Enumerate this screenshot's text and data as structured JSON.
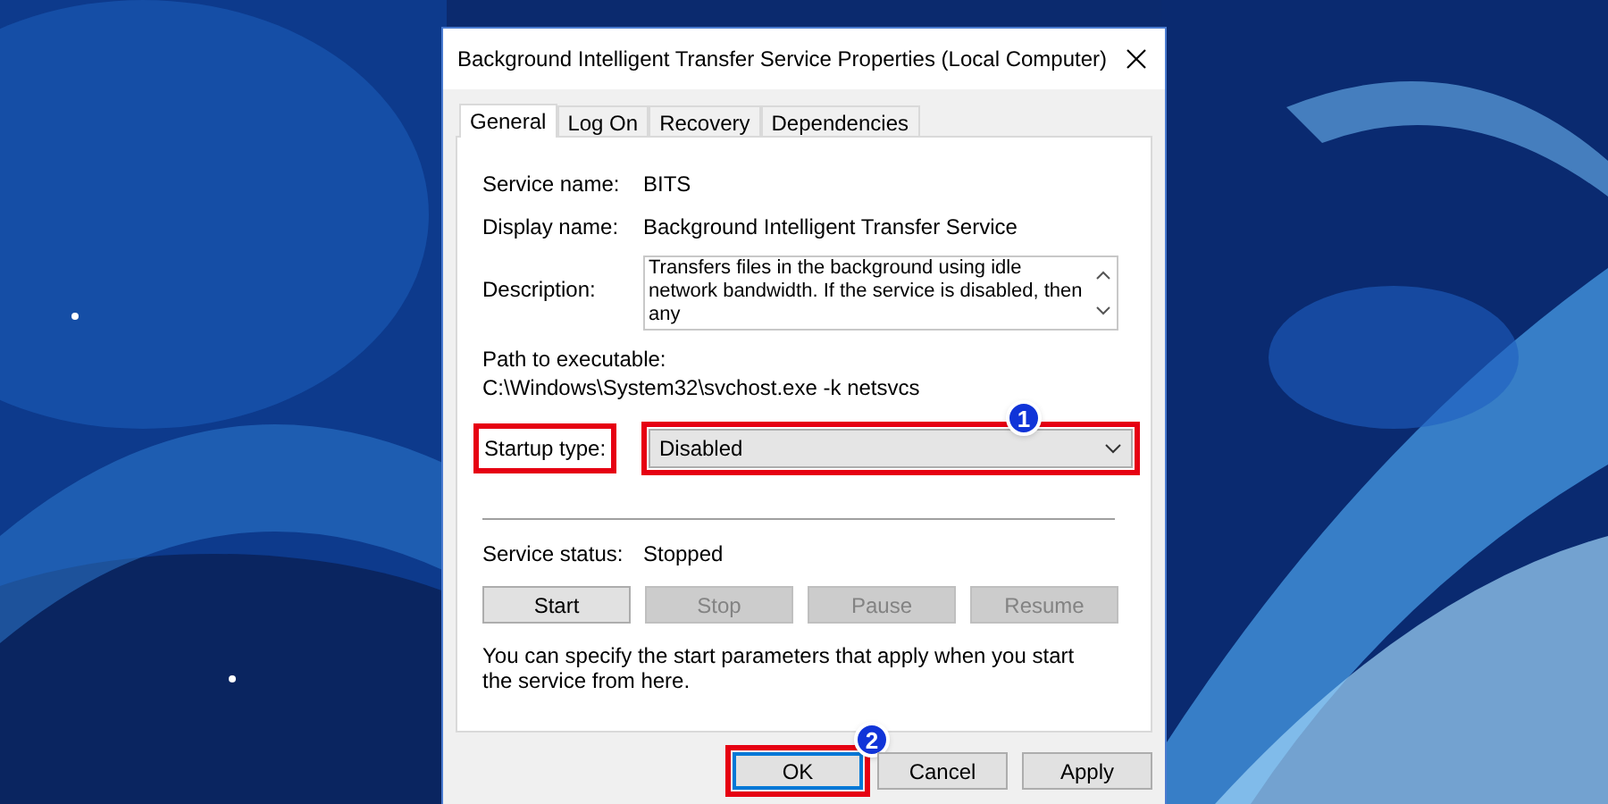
{
  "window": {
    "title": "Background Intelligent Transfer Service Properties (Local Computer)"
  },
  "tabs": [
    {
      "label": "General",
      "selected": true
    },
    {
      "label": "Log On",
      "selected": false
    },
    {
      "label": "Recovery",
      "selected": false
    },
    {
      "label": "Dependencies",
      "selected": false
    }
  ],
  "fields": [
    {
      "label": "Service name:",
      "value": "BITS"
    },
    {
      "label": "Display name:",
      "value": "Background Intelligent Transfer Service"
    }
  ],
  "description": {
    "label": "Description:",
    "text": "Transfers files in the background using idle network bandwidth. If the service is disabled, then any"
  },
  "path": {
    "label": "Path to executable:",
    "value": "C:\\Windows\\System32\\svchost.exe -k netsvcs"
  },
  "startup_type": {
    "label": "Startup type:",
    "value": "Disabled",
    "highlighted": true,
    "badge": "1"
  },
  "service_status": {
    "label": "Service status:",
    "value": "Stopped"
  },
  "service_buttons": [
    {
      "label": "Start",
      "disabled": false
    },
    {
      "label": "Stop",
      "disabled": true
    },
    {
      "label": "Pause",
      "disabled": true
    },
    {
      "label": "Resume",
      "disabled": true
    }
  ],
  "hint": "You can specify the start parameters that apply when you start the service from here.",
  "dialog_buttons": [
    {
      "label": "OK",
      "default": true,
      "highlighted": true,
      "badge": "2"
    },
    {
      "label": "Cancel",
      "default": false,
      "highlighted": false
    },
    {
      "label": "Apply",
      "default": false,
      "highlighted": false
    }
  ]
}
